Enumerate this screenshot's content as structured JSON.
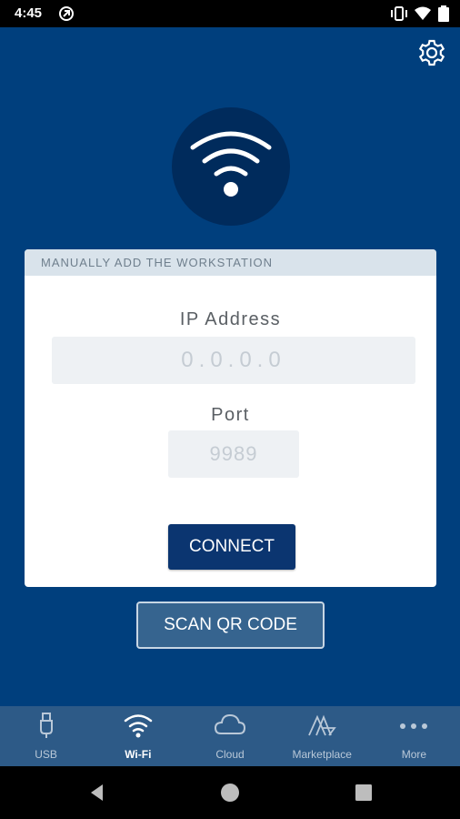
{
  "status_bar": {
    "time": "4:45"
  },
  "header": {
    "settings_icon": "gear-icon"
  },
  "card": {
    "title": "MANUALLY ADD THE WORKSTATION",
    "ip_label": "IP Address",
    "ip_placeholder": "0.0.0.0",
    "ip_value": "",
    "port_label": "Port",
    "port_placeholder": "9989",
    "port_value": "",
    "connect_label": "CONNECT"
  },
  "scan_label": "SCAN QR CODE",
  "tabs": [
    {
      "label": "USB",
      "icon": "usb-icon",
      "active": false
    },
    {
      "label": "Wi-Fi",
      "icon": "wifi-icon",
      "active": true
    },
    {
      "label": "Cloud",
      "icon": "cloud-icon",
      "active": false
    },
    {
      "label": "Marketplace",
      "icon": "marketplace-icon",
      "active": false
    },
    {
      "label": "More",
      "icon": "more-icon",
      "active": false
    }
  ],
  "colors": {
    "background": "#003f7d",
    "tab_bar": "#2d5a87",
    "connect_button": "#0b3570"
  }
}
